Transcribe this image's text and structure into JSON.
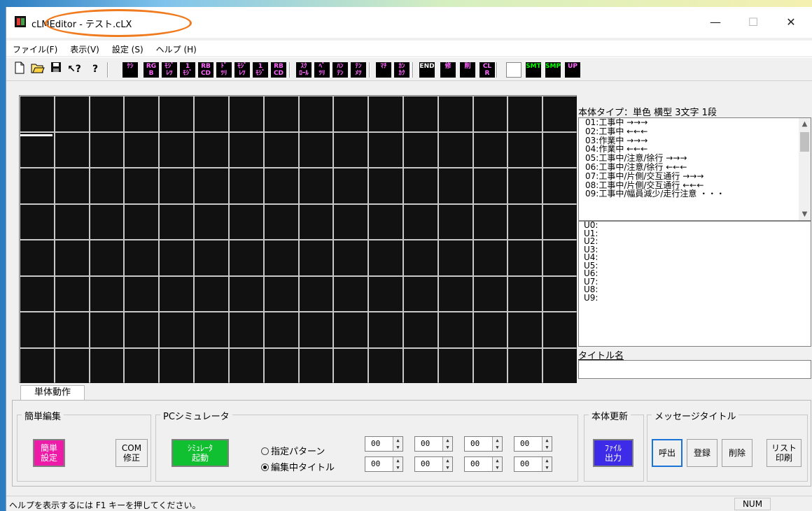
{
  "window": {
    "title": "cLMEditor - テスト.cLX",
    "controls": {
      "minimize": "—",
      "maximize": "☐",
      "close": "✕"
    }
  },
  "menu": [
    "ファイル(F)",
    "表示(V)",
    "設定 (S)",
    "ヘルプ (H)"
  ],
  "toolbar": {
    "std_icons": [
      "new-file-icon",
      "open-folder-icon",
      "save-icon",
      "context-help-icon",
      "help-icon"
    ],
    "buttons": [
      {
        "label": "ｹｼ",
        "color": "#ff66ff"
      },
      {
        "label": "RG\nB",
        "color": "#ff66ff"
      },
      {
        "label": "ﾓｼﾞ\nﾚﾂ",
        "color": "#ff66ff"
      },
      {
        "label": "1\nﾓｼﾞ",
        "color": "#ff66ff"
      },
      {
        "label": "RB\nCD",
        "color": "#ff66ff"
      },
      {
        "label": "ﾄﾞ\nﾂﾘ",
        "color": "#ff66ff"
      },
      {
        "label": "ﾓｼﾞ\nﾚﾂ",
        "color": "#ff66ff"
      },
      {
        "label": "1\nﾓｼﾞ",
        "color": "#ff66ff"
      },
      {
        "label": "RB\nCD",
        "color": "#ff66ff"
      },
      {
        "label": "ｽｸ\nﾛｰﾙ",
        "color": "#ff66ff"
      },
      {
        "label": "ﾍﾞ\nﾂﾘ",
        "color": "#ff66ff"
      },
      {
        "label": "ﾊﾝ\nﾃﾝ",
        "color": "#ff66ff"
      },
      {
        "label": "ﾃﾝ\nﾒﾂ",
        "color": "#ff66ff"
      },
      {
        "label": "ﾏﾁ",
        "color": "#ff66ff"
      },
      {
        "label": "ｶﾝ\nｶｸ",
        "color": "#ff66ff"
      },
      {
        "label": "END",
        "color": "#ffffff"
      },
      {
        "label": "修",
        "color": "#ff66ff"
      },
      {
        "label": "削",
        "color": "#ff66ff"
      },
      {
        "label": "CL\nR",
        "color": "#ff66ff"
      },
      {
        "label": "",
        "color": "#ff3333"
      },
      {
        "label": "SMT",
        "color": "#00ff00"
      },
      {
        "label": "SMP",
        "color": "#00ff00"
      },
      {
        "label": "UP",
        "color": "#ff66ff"
      }
    ]
  },
  "grid": {
    "cols": 16,
    "rows": 8
  },
  "body_type": "本体タイプ：単色 横型 3文字 1段",
  "messages": [
    "01:工事中 →→→",
    "02:工事中 ←←←",
    "03:作業中 →→→",
    "04:作業中 ←←←",
    "05:工事中/注意/徐行 →→→",
    "06:工事中/注意/徐行 ←←←",
    "07:工事中/片側/交互通行 →→→",
    "08:工事中/片側/交互通行 ←←←",
    "09:工事中/幅員減少/走行注意 ・・・"
  ],
  "user_patterns": [
    "U0:",
    "U1:",
    "U2:",
    "U3:",
    "U4:",
    "U5:",
    "U6:",
    "U7:",
    "U8:",
    "U9:"
  ],
  "title_field": {
    "label": "タイトル名",
    "value": ""
  },
  "tab": "単体動作",
  "groups": {
    "simple_edit": {
      "label": "簡単編集",
      "simple_settings": "簡単\n設定",
      "com_fix": "COM\n修正"
    },
    "pc_sim": {
      "label": "PCシミュレータ",
      "start": "ｼﾐｭﾚｰﾀ\n起動",
      "radio1": "指定パターン",
      "radio2": "編集中タイトル",
      "spin_row1": [
        "00",
        "00",
        "00",
        "00"
      ],
      "spin_row2": [
        "00",
        "00",
        "00",
        "00"
      ]
    },
    "body_update": {
      "label": "本体更新",
      "file_out": "ﾌｧｲﾙ\n出力"
    },
    "msg_title": {
      "label": "メッセージタイトル",
      "call": "呼出",
      "register": "登録",
      "delete": "削除",
      "list_print": "リスト\n印刷"
    }
  },
  "status": {
    "text": "ヘルプを表示するには F1 キーを押してください。",
    "num": "NUM"
  }
}
